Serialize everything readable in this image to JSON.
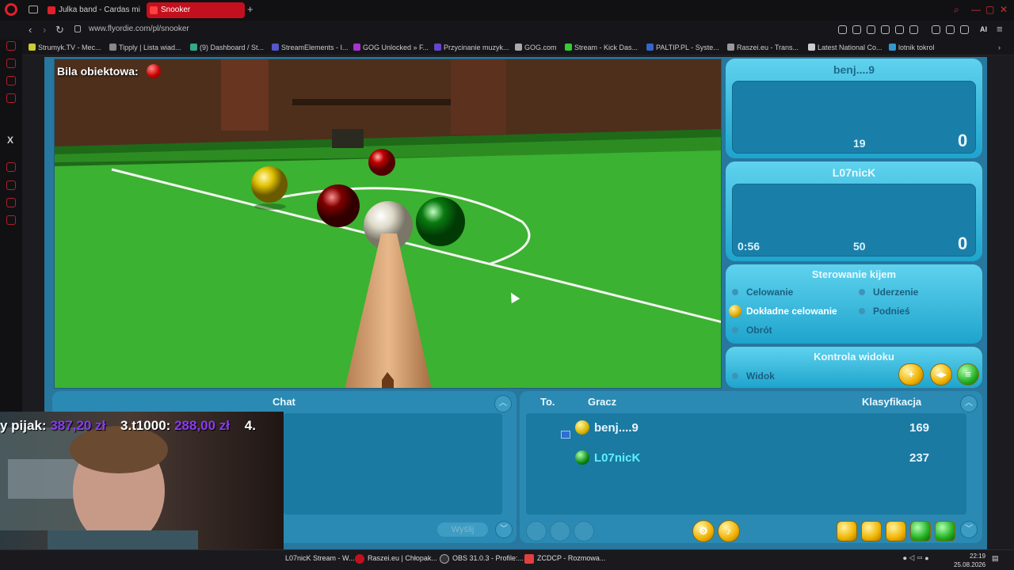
{
  "browser": {
    "tabs": [
      {
        "title": "Julka band - Cardas mi",
        "active": false
      },
      {
        "title": "Snooker",
        "active": true
      }
    ],
    "url": "www.flyordie.com/pl/snooker",
    "ai_label": "AI",
    "bookmarks": [
      "Strumyk.TV - Mec...",
      "Tipply | Lista wiad...",
      "(9) Dashboard / St...",
      "StreamElements - I...",
      "GOG Unlocked » F...",
      "Przycinanie muzyk...",
      "GOG.com",
      "Stream - Kick Das...",
      "PALTIP.PL - Syste...",
      "Raszei.eu - Trans...",
      "Latest National Co...",
      "lotnik tokrol"
    ]
  },
  "game": {
    "object_ball_label": "Bila obiektowa:",
    "player1": {
      "name": "benj....9",
      "break": "19",
      "score": "0"
    },
    "player2": {
      "name": "L07nicK",
      "timer": "0:56",
      "break": "50",
      "score": "0"
    },
    "cue_control": {
      "title": "Sterowanie kijem",
      "options": [
        "Celowanie",
        "Uderzenie",
        "Dokładne celowanie",
        "Podnieś",
        "Obrót"
      ],
      "selected": "Dokładne celowanie"
    },
    "view_control": {
      "title": "Kontrola widoku",
      "option": "Widok"
    },
    "chat": {
      "header": "Chat",
      "send_button": "Wyślij"
    },
    "ranking": {
      "headers": {
        "to": "To.",
        "player": "Gracz",
        "class": "Klasyfikacja"
      },
      "rows": [
        {
          "name": "benj....9",
          "score": "169",
          "ball": "yellow"
        },
        {
          "name": "L07nicK",
          "score": "237",
          "ball": "green"
        }
      ]
    }
  },
  "stream_overlay": {
    "donations": [
      {
        "name": "y pijak:",
        "amount": "387,20 zł"
      },
      {
        "name": "3.t1000:",
        "amount": "288,00 zł"
      },
      {
        "name": "4.",
        "amount": ""
      }
    ]
  },
  "taskbar": {
    "items": [
      "L07nicK Stream - W...",
      "Raszei.eu | Chłopak...",
      "OBS 31.0.3 - Profile:...",
      "ZCDCP - Rozmowa..."
    ],
    "time": "22:19",
    "date": "25.08.2026"
  },
  "colors": {
    "accent": "#c3101e",
    "panel": "#27779e",
    "felt": "#38b02e"
  }
}
